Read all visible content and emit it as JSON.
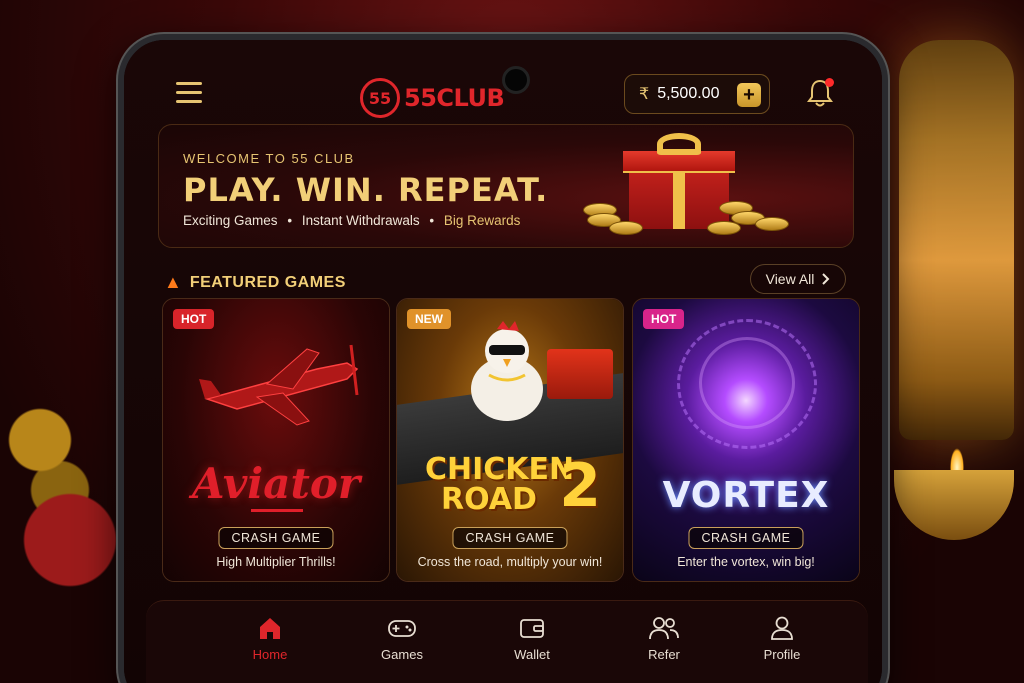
{
  "header": {
    "logo_badge": "55",
    "logo_text": "55CLUB",
    "currency_symbol": "₹",
    "balance": "5,500.00",
    "add_funds_symbol": "+"
  },
  "banner": {
    "eyebrow": "WELCOME TO 55 CLUB",
    "headline": "PLAY. WIN. REPEAT.",
    "features": [
      "Exciting Games",
      "Instant Withdrawals",
      "Big Rewards"
    ],
    "separator": "•"
  },
  "featured": {
    "title": "FEATURED GAMES",
    "view_all": "View All",
    "view_all_icon": "chevron-right-icon",
    "games": [
      {
        "name": "Aviator",
        "badge": "HOT",
        "category": "CRASH GAME",
        "tagline": "High Multiplier Thrills!",
        "badge_color": "#d8242a"
      },
      {
        "name_line1": "CHICKEN",
        "name_line2": "ROAD",
        "name_number": "2",
        "badge": "NEW",
        "category": "CRASH GAME",
        "tagline": "Cross the road, multiply your win!",
        "badge_color": "#e0922a"
      },
      {
        "name": "VORTEX",
        "badge": "HOT",
        "category": "CRASH GAME",
        "tagline": "Enter the vortex, win big!",
        "badge_color": "#d8248a"
      }
    ]
  },
  "bottom_nav": {
    "items": [
      {
        "label": "Home",
        "icon": "home-icon",
        "active": true
      },
      {
        "label": "Games",
        "icon": "gamepad-icon",
        "active": false
      },
      {
        "label": "Wallet",
        "icon": "wallet-icon",
        "active": false
      },
      {
        "label": "Refer",
        "icon": "users-icon",
        "active": false
      },
      {
        "label": "Profile",
        "icon": "user-icon",
        "active": false
      }
    ]
  },
  "colors": {
    "brand_red": "#e0262b",
    "gold": "#e6c472",
    "background": "#120404"
  }
}
